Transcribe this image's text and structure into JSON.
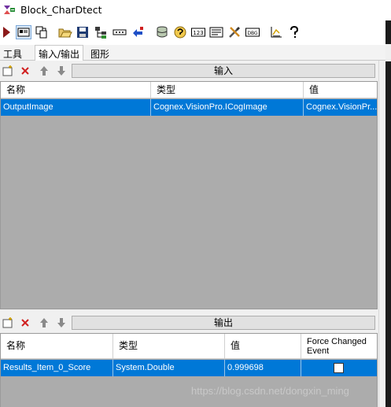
{
  "window": {
    "title": "Block_CharDtect"
  },
  "toolbar": {
    "icons": [
      "run-icon",
      "display-icon",
      "replace-icon",
      "open-folder-icon",
      "save-icon",
      "hierarchy-icon",
      "dots-icon",
      "reset-icon",
      "database-icon",
      "help-text-icon",
      "value-123-icon",
      "list-icon",
      "tools-icon",
      "dbg-icon",
      "chart-icon",
      "question-icon"
    ]
  },
  "tabs": [
    {
      "label": "工具",
      "active": false
    },
    {
      "label": "输入/输出",
      "active": true
    },
    {
      "label": "图形",
      "active": false
    }
  ],
  "input_section": {
    "button_label": "输入",
    "columns": [
      "名称",
      "类型",
      "值"
    ],
    "rows": [
      {
        "name": "OutputImage",
        "type": "Cognex.VisionPro.ICogImage",
        "value": "Cognex.VisionPr..."
      }
    ]
  },
  "output_section": {
    "button_label": "输出",
    "columns": [
      "名称",
      "类型",
      "值",
      "Force Changed Event"
    ],
    "rows": [
      {
        "name": "Results_Item_0_Score",
        "type": "System.Double",
        "value": "0.999698",
        "force_changed_event": false
      }
    ]
  },
  "watermark": "https://blog.csdn.net/dongxin_ming",
  "colors": {
    "selection": "#0078d7",
    "grid_empty": "#acacac",
    "panel": "#f0f0f0"
  }
}
